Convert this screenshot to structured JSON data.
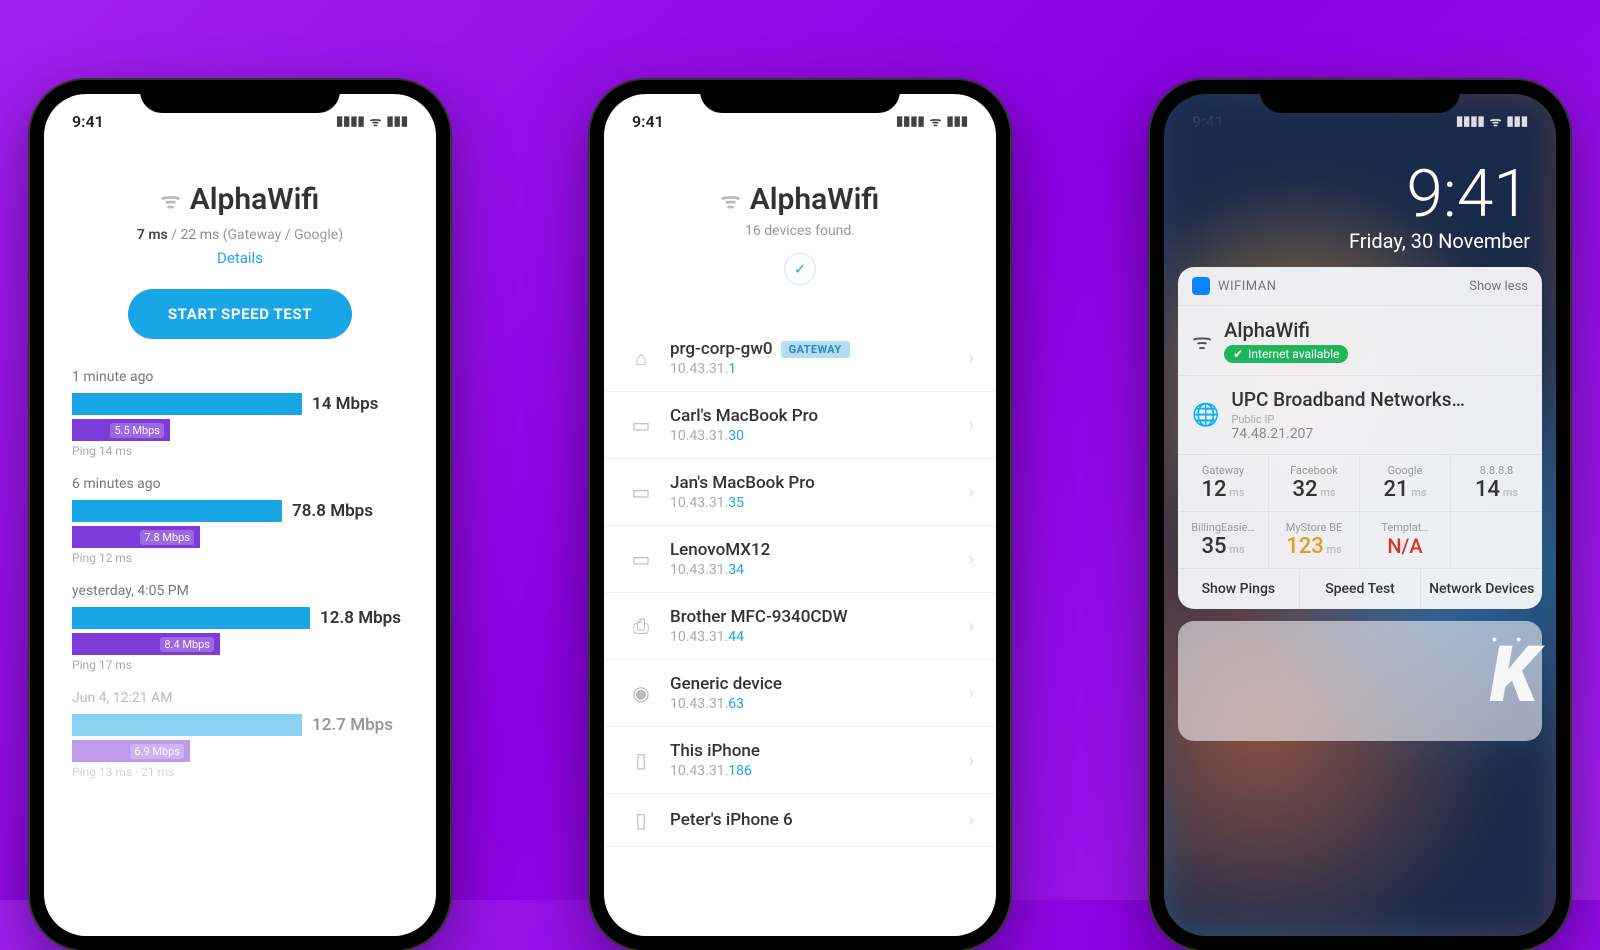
{
  "status": {
    "time": "9:41"
  },
  "phone1": {
    "network": "AlphaWifi",
    "lat_gateway": "7 ms",
    "lat_google": "22 ms",
    "lat_suffix": "(Gateway / Google)",
    "details": "Details",
    "button": "START SPEED TEST",
    "history": [
      {
        "time": "1 minute ago",
        "dl": "14 Mbps",
        "dl_w": 230,
        "ul": "5.5 Mbps",
        "ul_w": 98,
        "ping": "Ping 14 ms"
      },
      {
        "time": "6 minutes ago",
        "dl": "78.8 Mbps",
        "dl_w": 210,
        "ul": "7.8 Mbps",
        "ul_w": 128,
        "ping": "Ping 12 ms"
      },
      {
        "time": "yesterday, 4:05 PM",
        "dl": "12.8 Mbps",
        "dl_w": 238,
        "ul": "8.4 Mbps",
        "ul_w": 148,
        "ping": "Ping 17 ms"
      },
      {
        "time": "Jun 4, 12:21 AM",
        "dl": "12.7 Mbps",
        "dl_w": 230,
        "ul": "6.9 Mbps",
        "ul_w": 118,
        "ping": "Ping 13 ms · 21 ms",
        "faded": true
      }
    ]
  },
  "phone2": {
    "network": "AlphaWifi",
    "found": "16 devices found.",
    "devices": [
      {
        "name": "prg-corp-gw0",
        "ip_pre": "10.43.31.",
        "ip_end": "1",
        "badge": "GATEWAY",
        "icon": "router"
      },
      {
        "name": "Carl's MacBook Pro",
        "ip_pre": "10.43.31.",
        "ip_end": "30",
        "icon": "laptop"
      },
      {
        "name": "Jan's MacBook Pro",
        "ip_pre": "10.43.31.",
        "ip_end": "35",
        "icon": "laptop"
      },
      {
        "name": "LenovoMX12",
        "ip_pre": "10.43.31.",
        "ip_end": "34",
        "icon": "laptop"
      },
      {
        "name": "Brother MFC-9340CDW",
        "ip_pre": "10.43.31.",
        "ip_end": "44",
        "icon": "printer"
      },
      {
        "name": "Generic device",
        "ip_pre": "10.43.31.",
        "ip_end": "63",
        "icon": "device"
      },
      {
        "name": "This iPhone",
        "ip_pre": "10.43.31.",
        "ip_end": "186",
        "icon": "phone"
      },
      {
        "name": "Peter's iPhone 6",
        "ip_pre": "",
        "ip_end": "",
        "icon": "phone"
      }
    ]
  },
  "phone3": {
    "lock_time": "9:41",
    "lock_date": "Friday, 30 November",
    "widget_app": "WIFIMAN",
    "show_less": "Show less",
    "network": "AlphaWifi",
    "status": "Internet available",
    "isp": "UPC Broadband Networks…",
    "public_ip_label": "Public IP",
    "public_ip": "74.48.21.207",
    "pings": [
      {
        "label": "Gateway",
        "value": "12",
        "unit": "ms"
      },
      {
        "label": "Facebook",
        "value": "32",
        "unit": "ms"
      },
      {
        "label": "Google",
        "value": "21",
        "unit": "ms"
      },
      {
        "label": "8.8.8.8",
        "value": "14",
        "unit": "ms"
      },
      {
        "label": "BillingEasie…",
        "value": "35",
        "unit": "ms"
      },
      {
        "label": "MyStore BE",
        "value": "123",
        "unit": "ms",
        "style": "orange"
      },
      {
        "label": "Templat…",
        "value": "N/A",
        "unit": "",
        "style": "red"
      }
    ],
    "buttons": [
      "Show Pings",
      "Speed Test",
      "Network Devices"
    ]
  }
}
